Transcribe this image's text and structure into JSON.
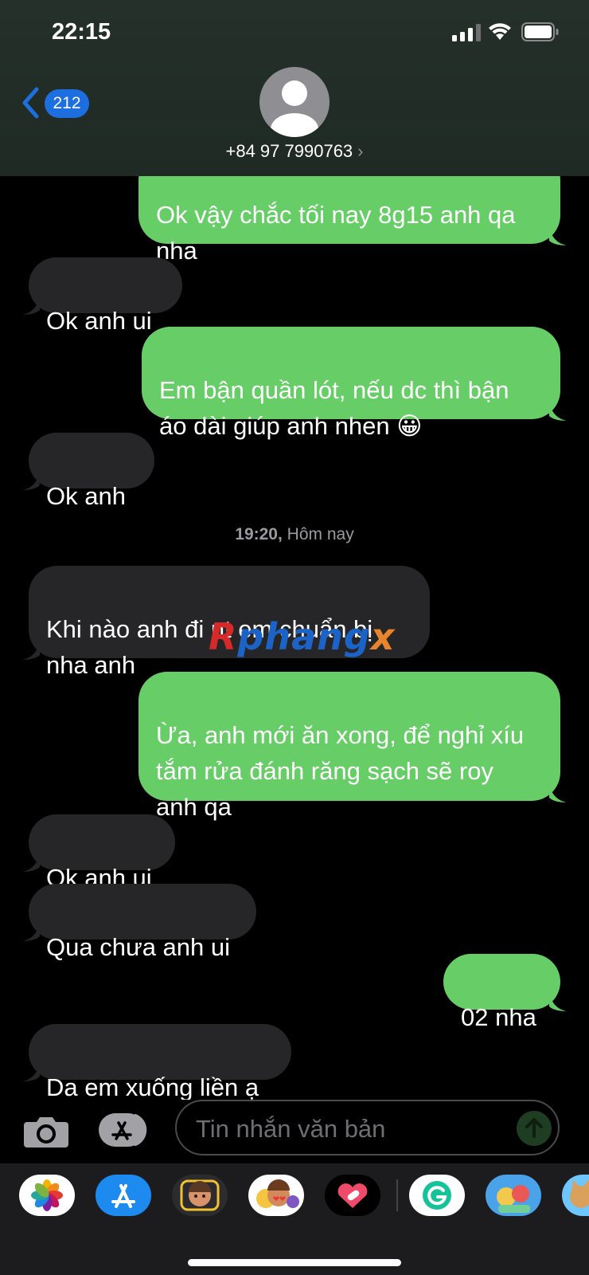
{
  "status_bar": {
    "time": "22:15"
  },
  "nav": {
    "back_count": "212",
    "contact": "+84 97 7990763",
    "chevron": "›"
  },
  "messages": [
    {
      "dir": "out",
      "text": "Ok vậy chắc tối nay 8g15 anh qa\nnha"
    },
    {
      "dir": "in",
      "text": "Ok anh ui"
    },
    {
      "dir": "out",
      "text": "Em bận quần lót, nếu dc thì bận\náo dài giúp anh nhen 😀"
    },
    {
      "dir": "in",
      "text": "Ok anh"
    },
    {
      "dir": "in",
      "text": "Khi nào anh đi  nt em chuẩn bị\nnha anh"
    },
    {
      "dir": "out",
      "text": "Ừa, anh mới ăn xong, để nghỉ xíu\ntắm rửa đánh răng sạch sẽ roy\nanh qa"
    },
    {
      "dir": "in",
      "text": "Ok anh ui"
    },
    {
      "dir": "in",
      "text": "Qua chưa anh ui"
    },
    {
      "dir": "out",
      "text": "02 nha"
    },
    {
      "dir": "in",
      "text": "Da em xuống liền ạ"
    }
  ],
  "timestamp": {
    "time": "19:20,",
    "day": "Hôm nay"
  },
  "watermark": {
    "first": "R",
    "middle": "phang",
    "last": "x"
  },
  "composer": {
    "placeholder": "Tin nhắn văn bản"
  },
  "drawer_apps": [
    "photos-icon",
    "app-store-icon",
    "memoji-icon",
    "animoji-icon",
    "digital-touch-icon",
    "grammarly-icon",
    "game-icon",
    "cat-game-icon"
  ],
  "colors": {
    "outgoing": "#67ce67",
    "incoming": "#262628",
    "accent": "#1d6fe0"
  }
}
